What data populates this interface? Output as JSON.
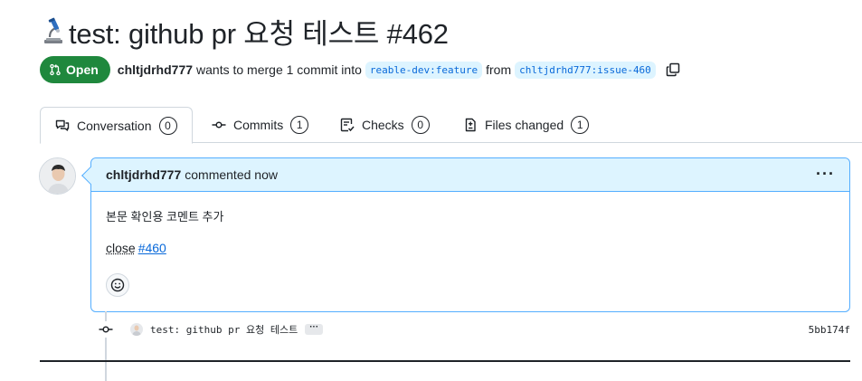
{
  "pr": {
    "title": "test: github pr 요청 테스트 #462",
    "title_icon": "microscope-icon",
    "state": "Open",
    "author": "chltjdrhd777",
    "merge_text": "wants to merge 1 commit into",
    "base_branch": "reable-dev:feature",
    "from_text": "from",
    "head_branch": "chltjdrhd777:issue-460",
    "state_color": "#1f883d"
  },
  "tabs": [
    {
      "label": "Conversation",
      "count": "0",
      "icon": "comment-discussion-icon",
      "selected": true
    },
    {
      "label": "Commits",
      "count": "1",
      "icon": "git-commit-icon",
      "selected": false
    },
    {
      "label": "Checks",
      "count": "0",
      "icon": "checklist-icon",
      "selected": false
    },
    {
      "label": "Files changed",
      "count": "1",
      "icon": "file-diff-icon",
      "selected": false
    }
  ],
  "comment": {
    "author": "chltjdrhd777",
    "timestamp": "commented now",
    "menu": "···",
    "body_line1": "본문 확인용 코멘트 추가",
    "close_word": "close",
    "issue_ref": "#460",
    "border_color": "#54aeff",
    "header_bg": "#ddf4ff"
  },
  "commit": {
    "message": "test: github pr 요청 테스트",
    "ellipsis": "···",
    "sha": "5bb174f"
  }
}
